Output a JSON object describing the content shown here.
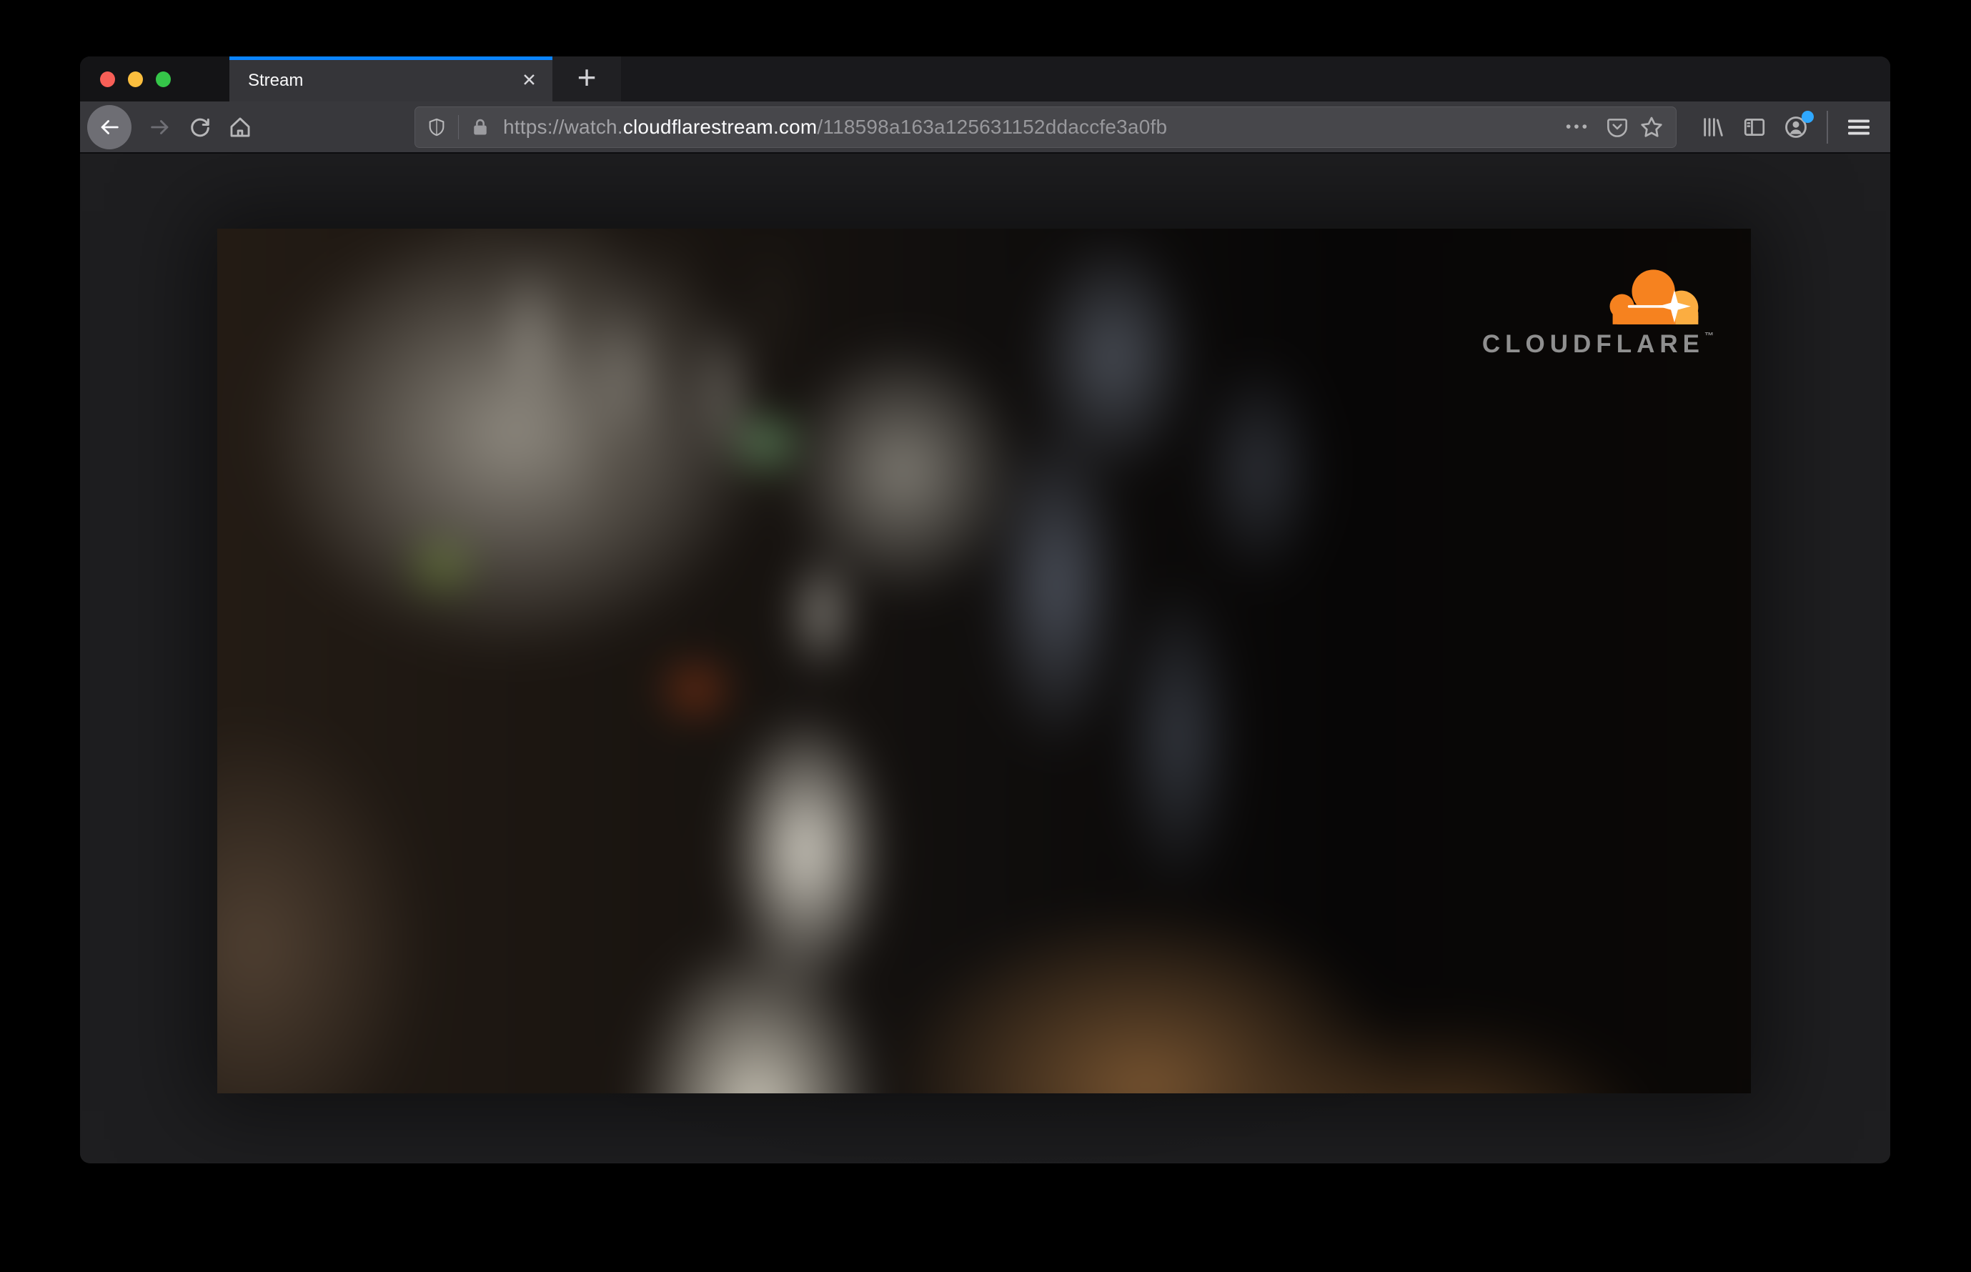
{
  "window": {
    "tab": {
      "title": "Stream"
    },
    "toolbar": {
      "url": {
        "scheme_prefix": "https://watch.",
        "domain": "cloudflarestream.com",
        "path": "/118598a163a125631152ddaccfe3a0fb"
      }
    },
    "page": {
      "video": {
        "brand": "CLOUDFLARE",
        "trademark": "™"
      }
    }
  },
  "icons": {
    "close_glyph": "✕",
    "plus_glyph": "+",
    "ellipsis_glyph": "•••",
    "back": "arrow-left",
    "forward": "arrow-right",
    "reload": "refresh-arrow",
    "home": "house",
    "tracking_protection": "shield",
    "connection_secure": "lock",
    "save_to_pocket": "pocket",
    "bookmark": "star",
    "library": "book-stack",
    "sidebar": "split-panel",
    "account": "person-circle",
    "menu": "hamburger"
  },
  "colors": {
    "accent_blue": "#0a84ff",
    "notification_blue": "#2fa8ff",
    "cloudflare_orange": "#f6821f",
    "cloudflare_orange_light": "#fbad41",
    "mac_red": "#f85f57",
    "mac_yellow": "#fbbe3e",
    "mac_green": "#35c649",
    "toolbar_gray": "#38383c",
    "urlbar_gray": "#47474b",
    "page_background": "#1e1e20"
  }
}
